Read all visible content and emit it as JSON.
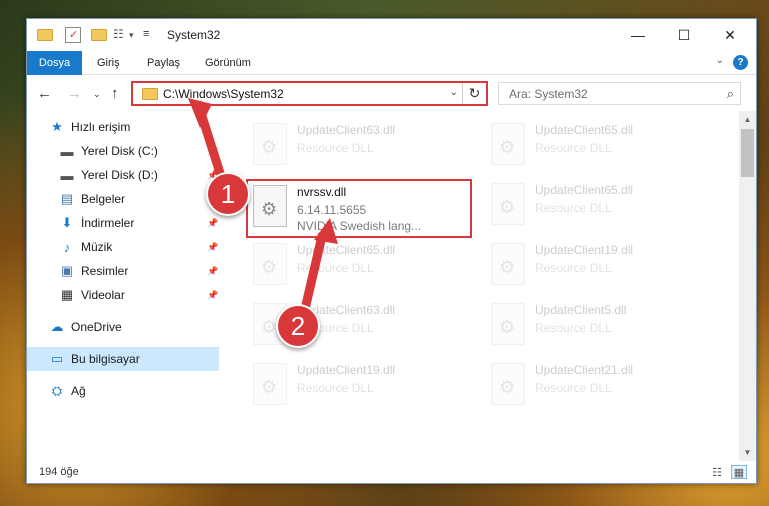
{
  "window": {
    "title": "System32"
  },
  "controls": {
    "minimize": "—",
    "maximize": "☐",
    "close": "✕"
  },
  "ribbon": {
    "tabs": [
      {
        "label": "Dosya"
      },
      {
        "label": "Giriş"
      },
      {
        "label": "Paylaş"
      },
      {
        "label": "Görünüm"
      }
    ],
    "help": "?"
  },
  "address": {
    "path": "C:\\Windows\\System32"
  },
  "search": {
    "placeholder": "Ara: System32"
  },
  "sidebar": {
    "items": [
      {
        "label": "Hızlı erişim",
        "icon": "star-icon"
      },
      {
        "label": "Yerel Disk (C:)",
        "icon": "drive-icon"
      },
      {
        "label": "Yerel Disk (D:)",
        "icon": "drive-icon"
      },
      {
        "label": "Belgeler",
        "icon": "documents-icon"
      },
      {
        "label": "İndirmeler",
        "icon": "download-icon"
      },
      {
        "label": "Müzik",
        "icon": "music-icon"
      },
      {
        "label": "Resimler",
        "icon": "pictures-icon"
      },
      {
        "label": "Videolar",
        "icon": "videos-icon"
      },
      {
        "label": "OneDrive",
        "icon": "cloud-icon"
      },
      {
        "label": "Bu bilgisayar",
        "icon": "computer-icon"
      },
      {
        "label": "Ağ",
        "icon": "network-icon"
      }
    ]
  },
  "files": {
    "ghost": [
      {
        "name": "UpdateClient63.dll",
        "type": "Resource DLL"
      },
      {
        "name": "UpdateClient65.dll",
        "type": "Resource DLL"
      },
      {
        "name": "UpdateClient65.dll",
        "type": "Resource DLL"
      },
      {
        "name": "UpdateClient19.dll",
        "type": "Resource DLL"
      },
      {
        "name": "UpdateClient65.dll",
        "type": "Resource DLL"
      },
      {
        "name": "UpdateClient63.dll",
        "type": "Resource DLL"
      },
      {
        "name": "UpdateClient5.dll",
        "type": "Resource DLL"
      },
      {
        "name": "UpdateClient19.dll",
        "type": "Resource DLL"
      },
      {
        "name": "UpdateClient21.dll",
        "type": "Resource DLL"
      }
    ],
    "selected": {
      "name": "nvrssv.dll",
      "version": "6.14.11.5655",
      "description": "NVIDIA Swedish lang..."
    }
  },
  "status": {
    "count": "194 öğe"
  },
  "callouts": {
    "one": "1",
    "two": "2"
  },
  "colors": {
    "accent": "#1979ca",
    "highlight": "#d9383a"
  }
}
